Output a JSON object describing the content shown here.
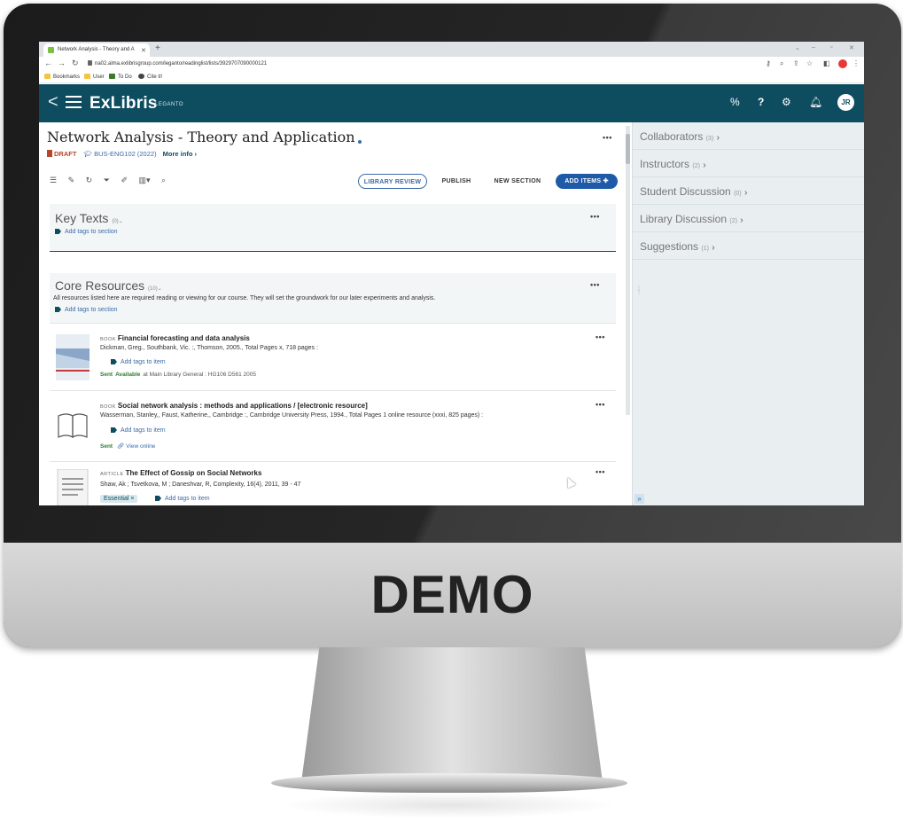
{
  "brand_label": "DEMO",
  "browser": {
    "tab_title": "Network Analysis - Theory and A",
    "url": "na02.alma.exlibrisgroup.com/leganto/readinglist/lists/3929707090000121",
    "bookmarks": [
      "Bookmarks",
      "User",
      "To Do",
      "Cite it!"
    ]
  },
  "app": {
    "logo": "ExLibris",
    "logo_sub": "LEGANTO",
    "avatar_initials": "JR",
    "colors": {
      "header": "#0e4d60",
      "accent": "#1e5aa8",
      "draft": "#b6472b",
      "available": "#2e7d32"
    }
  },
  "list": {
    "title": "Network Analysis - Theory and Application",
    "status": "DRAFT",
    "course": "BUS-ENG102 (2022)",
    "more_info": "More info",
    "buttons": {
      "library_review": "LIBRARY REVIEW",
      "publish": "PUBLISH",
      "new_section": "NEW SECTION",
      "add_items": "ADD ITEMS"
    }
  },
  "sections": [
    {
      "title": "Key Texts",
      "count": "(0)",
      "tags": "Add tags to section"
    },
    {
      "title": "Core Resources",
      "count": "(10)",
      "description": "All resources listed here are required reading or viewing for our course. They will set the groundwork for our later experiments and analysis.",
      "tags": "Add tags to section"
    }
  ],
  "items": [
    {
      "type": "BOOK",
      "title": "Financial forecasting and data analysis",
      "authors": "Dickman, Greg., Southbank, Vic. :, Thomson, 2005., Total Pages x, 718 pages :",
      "tags": "Add tags to item",
      "sent": "Sent",
      "availability": "Available",
      "location": "at Main Library General : HG106 D561 2005"
    },
    {
      "type": "BOOK",
      "title": "Social network analysis : methods and applications / [electronic resource]",
      "authors": "Wasserman, Stanley,, Faust, Katherine,, Cambridge :, Cambridge University Press, 1994., Total Pages 1 online resource (xxxi, 825 pages) :",
      "tags": "Add tags to item",
      "sent": "Sent",
      "view_online": "View online"
    },
    {
      "type": "ARTICLE",
      "title": "The Effect of Gossip on Social Networks",
      "authors": "Shaw, Ak ; Tsvetkova, M ; Daneshvar, R, Complexity, 16(4), 2011, 39 - 47",
      "tag_essential": "Essential ×",
      "tags": "Add tags to item"
    }
  ],
  "sidebar": [
    {
      "label": "Collaborators",
      "count": "(3)"
    },
    {
      "label": "Instructors",
      "count": "(2)"
    },
    {
      "label": "Student Discussion",
      "count": "(0)"
    },
    {
      "label": "Library Discussion",
      "count": "(2)"
    },
    {
      "label": "Suggestions",
      "count": "(1)"
    }
  ]
}
